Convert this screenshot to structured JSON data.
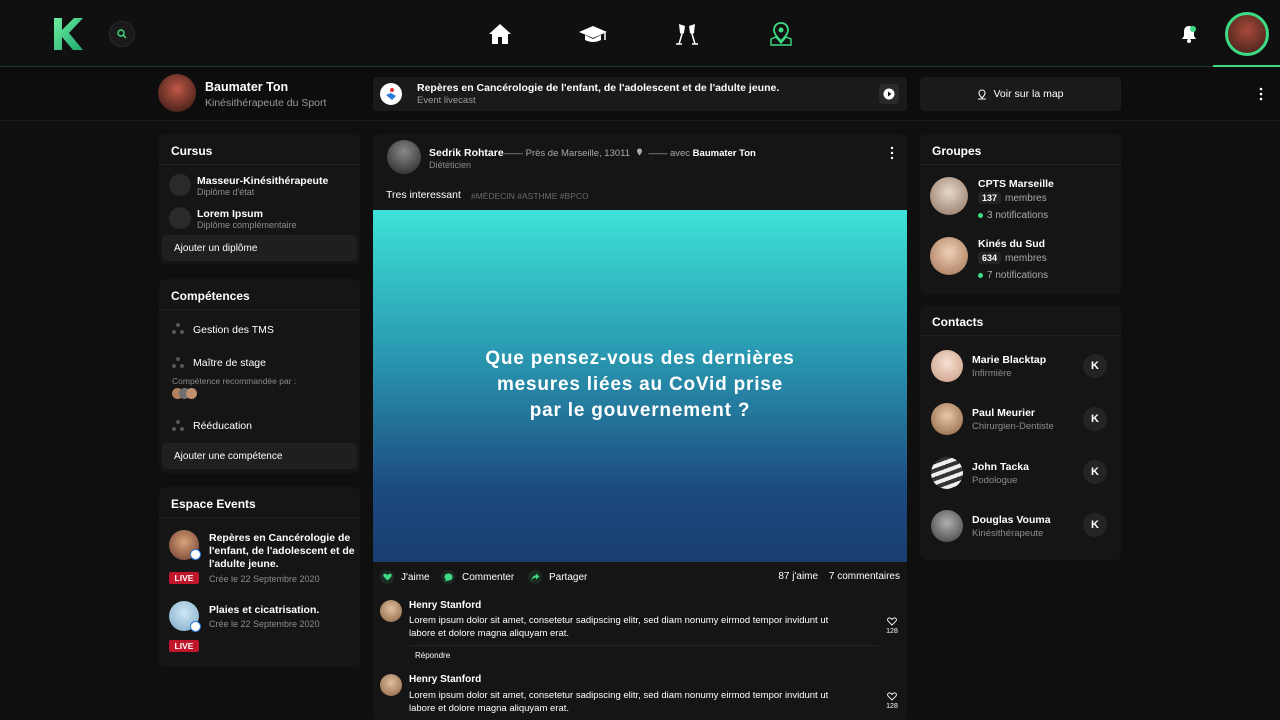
{
  "colors": {
    "accent": "#3ddc84",
    "live": "#c0152a",
    "background": "#0f0f0f",
    "card": "#151515"
  },
  "topbar": {
    "icons": [
      "logo-k-icon",
      "search-icon",
      "home-icon",
      "graduation-cap-icon",
      "cheers-icon",
      "map-pin-icon",
      "bell-icon"
    ]
  },
  "profile": {
    "name": "Baumater Ton",
    "role": "Kinésithérapeute du Sport"
  },
  "event_banner": {
    "title": "Repères en Cancérologie de l'enfant, de l'adolescent et de l'adulte jeune.",
    "subtitle": "Event livecast"
  },
  "map_button": {
    "label": "Voir sur la map"
  },
  "cursus": {
    "title": "Cursus",
    "items": [
      {
        "title": "Masseur-Kinésithérapeute",
        "sub": "Diplôme d'état"
      },
      {
        "title": "Lorem Ipsum",
        "sub": "Diplôme complémentaire"
      }
    ],
    "add_label": "Ajouter un diplôme"
  },
  "competences": {
    "title": "Compétences",
    "items": [
      "Gestion des TMS",
      "Maître de stage",
      "Rééducation"
    ],
    "recommended_label": "Compétence recommandée par :",
    "add_label": "Ajouter une compétence"
  },
  "events": {
    "title": "Espace Events",
    "items": [
      {
        "title_l1": "Repères en Cancérologie de",
        "title_l2": "l'enfant, de l'adolescent et de",
        "title_l3": "l'adulte jeune.",
        "date": "Crée le 22 Septembre 2020",
        "live": "LIVE"
      },
      {
        "title_l1": "Plaies et cicatrisation.",
        "date": "Crée le 22 Septembre 2020",
        "live": "LIVE"
      }
    ]
  },
  "post": {
    "author": "Sedrik Rohtare",
    "location": "—— Près de Marseille, 13011",
    "with_prefix": "—— avec",
    "with_name": "Baumater Ton",
    "role": "Diététicien",
    "text": "Tres interessant",
    "tags": "#MÉDECIN  #ASTHME  #BPCO",
    "question_l1": "Que pensez-vous des dernières",
    "question_l2": "mesures liées au CoVid prise",
    "question_l3": "par le gouvernement ?",
    "actions": {
      "like": "J'aime",
      "comment": "Commenter",
      "share": "Partager"
    },
    "likes": "87 j'aime",
    "comments_count": "7 commentaires",
    "comments": [
      {
        "name": "Henry Stanford",
        "l1": "Lorem ipsum dolor sit amet, consetetur sadipscing elitr, sed diam nonumy eirmod tempor invidunt ut",
        "l2": "labore et dolore magna aliquyam erat.",
        "likes": "128",
        "reply": "Répondre"
      },
      {
        "name": "Henry Stanford",
        "l1": "Lorem ipsum dolor sit amet, consetetur sadipscing elitr, sed diam nonumy eirmod tempor invidunt ut",
        "l2": "labore et dolore magna aliquyam erat.",
        "likes": "128"
      }
    ]
  },
  "groupes": {
    "title": "Groupes",
    "items": [
      {
        "name": "CPTS Marseille",
        "count": "137",
        "members_label": "membres",
        "notif": "3 notifications"
      },
      {
        "name": "Kinés du Sud",
        "count": "634",
        "members_label": "membres",
        "notif": "7 notifications"
      }
    ]
  },
  "contacts": {
    "title": "Contacts",
    "button_label": "K",
    "items": [
      {
        "name": "Marie Blacktap",
        "role": "Infirmière"
      },
      {
        "name": "Paul Meurier",
        "role": "Chirurgien-Dentiste"
      },
      {
        "name": "John Tacka",
        "role": "Podologue"
      },
      {
        "name": "Douglas Vouma",
        "role": "Kinésithérapeute"
      }
    ]
  }
}
